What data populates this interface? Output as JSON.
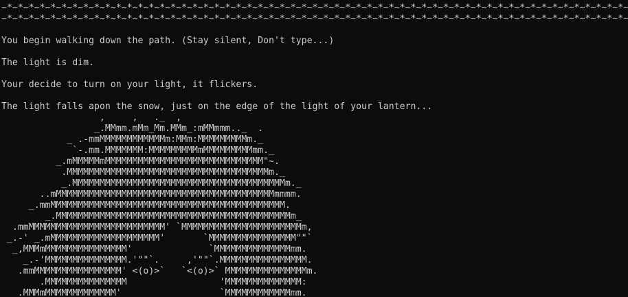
{
  "terminal": {
    "lines": [
      "~*~*~*~*~*~*~*~*~*~*~*~*~*~*~*~*~*~*~*~*~*~*~*~*~*~*~*~*~*~*~*~*~*~*~*~*~*~*~*~*~*~*~*~*~*~*~*~*~*~*~*~*~*~*~*~*~*~*~*~*~*~*~*~*~*~*~*~*~*~*~*~*~*~*~*~*~*~*~*~*~*~*~*~*~*~*~*~*~*~*~*~*~*~*~*~*~*~*~*",
      "~*~*~*~*~*~*~*~*~*~*~*~*~*~*~*~*~*~*~*~*~*~*~*~*~*~*~*~*~*~*~*~*~*~*~*~*~*~*~*~*~*~*~*~*~*~*~*~*~*~*~*~*~*~*~*~*~*~*~*~*~*~*~*~*~*~*~*~*~*~*~*~*~*~*~*~*~*~*~*~*~*~*~*~*~*~*~*~*~*~*~*~*~*~*~*~*~*~*~",
      "",
      "You begin walking down the path. (Stay silent, Don't type...)",
      "",
      "The light is dim.",
      "",
      "Your decide to turn on your light, it flickers.",
      "",
      "The light falls apon the snow, just on the edge of the light of your lantern...",
      "                  ,     ,   ._  ,",
      "                 _.MMmm.mMm_Mm.MMm_:mMMmmm.._  .",
      "            _ .-mmMMMMMMMMMMMMm:MMm:MMMMMMMMMm._",
      "             `-.mm.MMMMMMM:MMMMMMMMMmMMMMMMMMMmm._",
      "          _.mMMMMMmMMMMMMMMMMMMMMMMMMMMMMMMMMMMM\"~.",
      "           .MMMMMMMMMMMMMMMMMMMMMMMMMMMMMMMMMMMMMm._",
      "           _.MMMMMMMMMMMMMMMMMMMMMMMMMMMMMMMMMMMMMMMm._",
      "       ..mMMMMMMMMMMMMMMMMMMMMMMMMMMMMMMMMMMMMMMMMmmmm.",
      "     _.mmMMMMMMMMMMMMMMMMMMMMMMMMMMMMMMMMMMMMMMMMMMM.",
      "        _.MMMMMMMMMMMMMMMMMMMMMMMMMMMMMMMMMMMMMMMMMMMm_",
      "  .mmMMMMMMMMMMMMMMMMMMMMMMMMM' `MMMMMMMMMMMMMMMMMMMMMMm,",
      " _.-' _.mMMMMMMMMMMMMMMMMMMMM'       `MMMMMMMMMMMMMMMM\"\"`",
      "  _,MMMmMMMMMMMMMMMMMMM'              `MMMMMMMMMMMMMMmm.",
      "    _.-'MMMMMMMMMMMMMMM.'\"\"`.     ,'\"\"`.MMMMMMMMMMMMMMMM.",
      "   .mmMMMMMMMMMMMMMMMM' <(o)>`   `<(o)>` MMMMMMMMMMMMMMMm.",
      "       .MMMMMMMMMMMMMMM                 'MMMMMMMMMMMMMM:",
      "   .MMMmMMMMMMMMMMMMM'                  `MMMMMMMMMMMMmm."
    ]
  }
}
